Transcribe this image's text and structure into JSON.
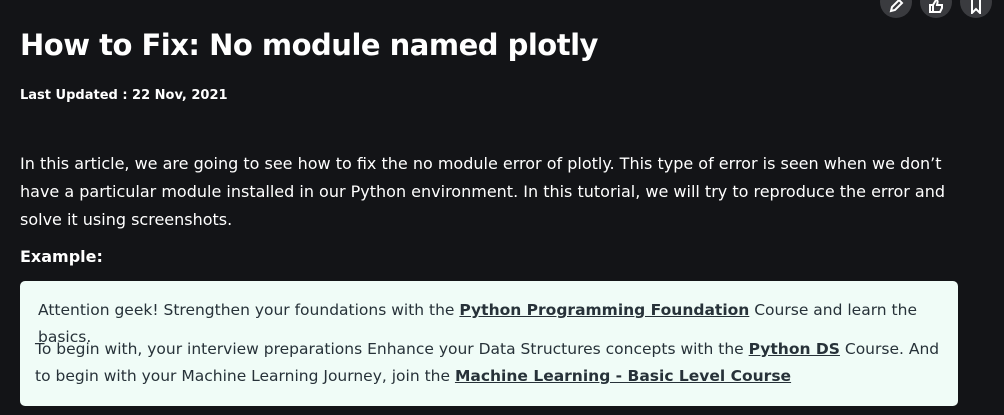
{
  "actions": {
    "icons": [
      "pencil-icon",
      "thumbs-up-icon",
      "bookmark-icon"
    ]
  },
  "article": {
    "title": "How to Fix: No module named plotly",
    "last_updated": "Last Updated : 22 Nov, 2021",
    "intro": "In this article, we are going to see how to fix the no module error of plotly. This type of error is seen when we don’t have a particular module installed in our Python environment. In this tutorial, we will try to reproduce the error and solve it using screenshots.",
    "example_heading": "Example:"
  },
  "promo": {
    "line1_pre": "Attention geek! Strengthen your foundations with the ",
    "line1_link": "Python Programming Foundation",
    "line1_post": " Course and learn the basics.",
    "line2_pre": "To begin with, your interview preparations Enhance your Data Structures concepts with the ",
    "line2_link": "Python DS",
    "line2_mid": " Course. And to begin with your Machine Learning Journey, join the ",
    "line2_link2": "Machine Learning - Basic Level Course"
  }
}
